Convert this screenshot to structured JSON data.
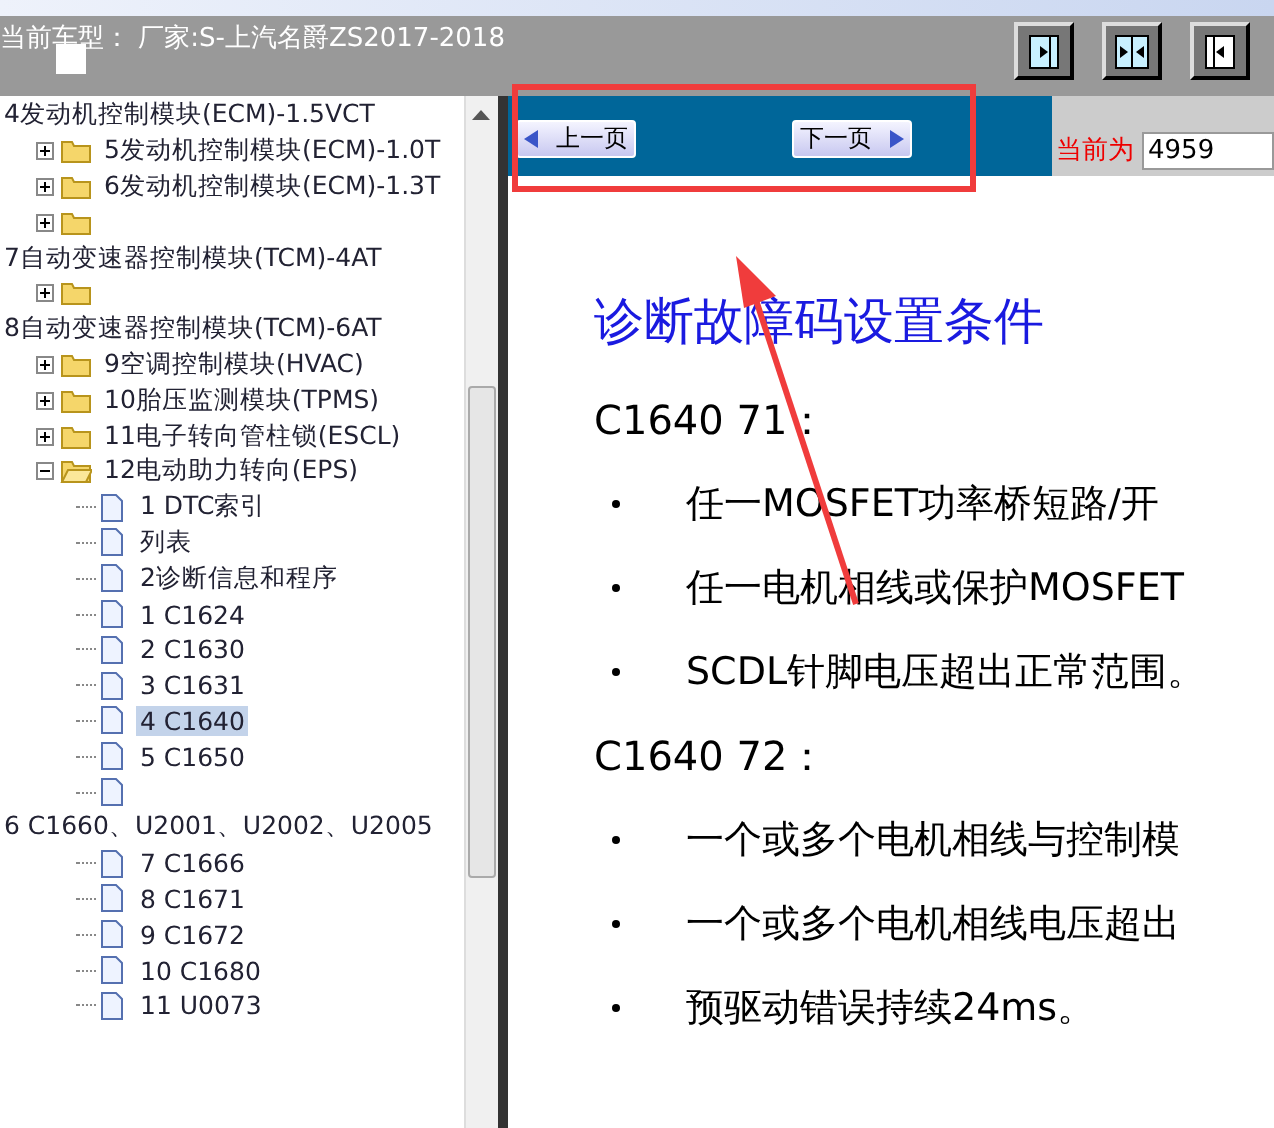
{
  "header": {
    "title": "当前车型： 厂家:S-上汽名爵ZS2017-2018"
  },
  "tree": [
    {
      "kind": "heading",
      "label": "4发动机控制模块(ECM)-1.5VCT",
      "children": [
        {
          "kind": "folder",
          "label": "5发动机控制模块(ECM)-1.0T",
          "expanded": false
        },
        {
          "kind": "folder",
          "label": "6发动机控制模块(ECM)-1.3T",
          "expanded": false
        },
        {
          "kind": "folder",
          "expanded": false
        }
      ]
    },
    {
      "kind": "heading",
      "label": "7自动变速器控制模块(TCM)-4AT",
      "children": [
        {
          "kind": "folder",
          "expanded": false
        }
      ]
    },
    {
      "kind": "heading",
      "label": "8自动变速器控制模块(TCM)-6AT",
      "children": [
        {
          "kind": "folder",
          "label": "9空调控制模块(HVAC)",
          "expanded": false
        },
        {
          "kind": "folder",
          "label": "10胎压监测模块(TPMS)",
          "expanded": false
        },
        {
          "kind": "folder",
          "label": "11电子转向管柱锁(ESCL)",
          "expanded": false
        },
        {
          "kind": "folder",
          "label": "12电动助力转向(EPS)",
          "expanded": true,
          "children": [
            {
              "kind": "doc",
              "label": "1 DTC索引",
              "selected": false
            },
            {
              "kind": "doc",
              "label": "列表",
              "selected": false
            },
            {
              "kind": "doc",
              "label": "2诊断信息和程序",
              "selected": false
            },
            {
              "kind": "doc",
              "label": "1 C1624",
              "selected": false
            },
            {
              "kind": "doc",
              "label": "2 C1630",
              "selected": false
            },
            {
              "kind": "doc",
              "label": "3 C1631",
              "selected": false
            },
            {
              "kind": "doc",
              "label": "4 C1640",
              "selected": true
            },
            {
              "kind": "doc",
              "label": "5 C1650",
              "selected": false
            },
            {
              "kind": "doc",
              "selected": false
            },
            {
              "kind": "heading",
              "label": "6 C1660、U2001、U2002、U2005"
            },
            {
              "kind": "doc",
              "label": "7 C1666",
              "selected": false
            },
            {
              "kind": "doc",
              "label": "8 C1671",
              "selected": false
            },
            {
              "kind": "doc",
              "label": "9 C1672",
              "selected": false
            },
            {
              "kind": "doc",
              "label": "10 C1680",
              "selected": false
            },
            {
              "kind": "doc",
              "label": "11 U0073",
              "selected": false
            }
          ]
        }
      ]
    }
  ],
  "nav": {
    "prev": "上一页",
    "next": "下一页",
    "current_label": "当前为",
    "current_value": "4959"
  },
  "document": {
    "title": "诊断故障码设置条件",
    "blocks": [
      {
        "kind": "heading",
        "text": "C1640 71："
      },
      {
        "kind": "bullet",
        "text": "任一MOSFET功率桥短路/开"
      },
      {
        "kind": "bullet",
        "text": "任一电机相线或保护MOSFET"
      },
      {
        "kind": "bullet",
        "text": "SCDL针脚电压超出正常范围。"
      },
      {
        "kind": "heading",
        "text": "C1640 72："
      },
      {
        "kind": "bullet",
        "text": "一个或多个电机相线与控制模"
      },
      {
        "kind": "bullet",
        "text": "一个或多个电机相线电压超出"
      },
      {
        "kind": "bullet",
        "text": "预驱动错误持续24ms。"
      }
    ]
  }
}
